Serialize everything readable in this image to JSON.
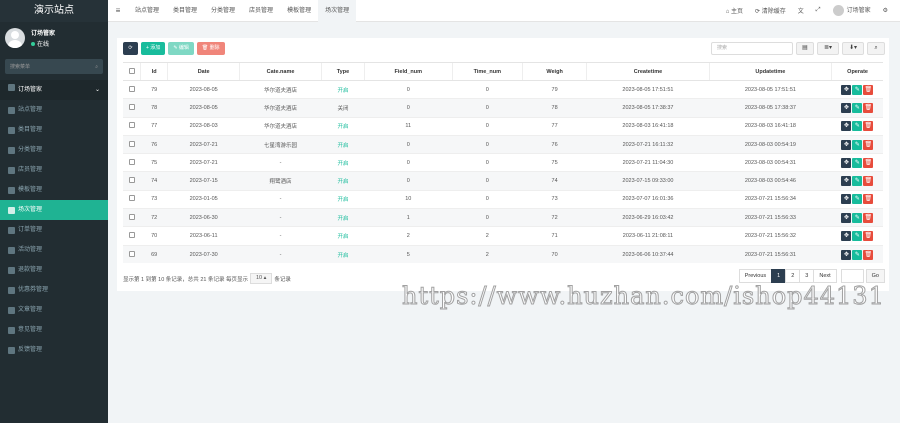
{
  "sidebar": {
    "brand": "演示站点",
    "user_name": "订场管家",
    "user_status": "在线",
    "search_placeholder": "搜索菜单",
    "group_label": "订场管家",
    "items": [
      {
        "label": "站点管理",
        "icon": "home-icon"
      },
      {
        "label": "类目管理",
        "icon": "list-icon"
      },
      {
        "label": "分类管理",
        "icon": "folder-icon"
      },
      {
        "label": "店员管理",
        "icon": "users-icon"
      },
      {
        "label": "模板管理",
        "icon": "template-icon"
      },
      {
        "label": "场次管理",
        "icon": "grid-icon",
        "active": true
      },
      {
        "label": "订单管理",
        "icon": "order-icon"
      },
      {
        "label": "活动管理",
        "icon": "activity-icon"
      },
      {
        "label": "退款管理",
        "icon": "refund-icon"
      },
      {
        "label": "优惠券管理",
        "icon": "coupon-icon"
      },
      {
        "label": "文章管理",
        "icon": "article-icon"
      },
      {
        "label": "意见管理",
        "icon": "comment-icon"
      },
      {
        "label": "反馈管理",
        "icon": "feedback-icon"
      }
    ]
  },
  "topnav": {
    "toggle_icon": "menu-icon",
    "tabs": [
      "站点管理",
      "类目管理",
      "分类管理",
      "店员管理",
      "模板管理",
      "场次管理"
    ],
    "active_tab": 5,
    "home": "主页",
    "clear_cache": "清除缓存",
    "user": "订场管家"
  },
  "toolbar": {
    "add": "+ 添加",
    "edit": "✎ 编辑",
    "delete": "🗑 删除",
    "search_placeholder": "搜索"
  },
  "table": {
    "headers": [
      "Id",
      "Date",
      "Cate.name",
      "Type",
      "Field_num",
      "Time_num",
      "Weigh",
      "Createtime",
      "Updatetime",
      "Operate"
    ],
    "rows": [
      {
        "id": "79",
        "date": "2023-08-05",
        "cate": "华尔道夫酒店",
        "type": "开启",
        "on": true,
        "field": "0",
        "time": "0",
        "weigh": "79",
        "create": "2023-08-05 17:51:51",
        "update": "2023-08-05 17:51:51"
      },
      {
        "id": "78",
        "date": "2023-08-05",
        "cate": "华尔道夫酒店",
        "type": "关闭",
        "on": false,
        "field": "0",
        "time": "0",
        "weigh": "78",
        "create": "2023-08-05 17:38:37",
        "update": "2023-08-05 17:38:37"
      },
      {
        "id": "77",
        "date": "2023-08-03",
        "cate": "华尔道夫酒店",
        "type": "开启",
        "on": true,
        "field": "11",
        "time": "0",
        "weigh": "77",
        "create": "2023-08-03 16:41:18",
        "update": "2023-08-03 16:41:18"
      },
      {
        "id": "76",
        "date": "2023-07-21",
        "cate": "七星湾游乐园",
        "type": "开启",
        "on": true,
        "field": "0",
        "time": "0",
        "weigh": "76",
        "create": "2023-07-21 16:11:32",
        "update": "2023-08-03 00:54:19"
      },
      {
        "id": "75",
        "date": "2023-07-21",
        "cate": "-",
        "type": "开启",
        "on": true,
        "field": "0",
        "time": "0",
        "weigh": "75",
        "create": "2023-07-21 11:04:30",
        "update": "2023-08-03 00:54:31"
      },
      {
        "id": "74",
        "date": "2023-07-15",
        "cate": "翔鹭酒店",
        "type": "开启",
        "on": true,
        "field": "0",
        "time": "0",
        "weigh": "74",
        "create": "2023-07-15 09:33:00",
        "update": "2023-08-03 00:54:46"
      },
      {
        "id": "73",
        "date": "2023-01-05",
        "cate": "-",
        "type": "开启",
        "on": true,
        "field": "10",
        "time": "0",
        "weigh": "73",
        "create": "2023-07-07 16:01:36",
        "update": "2023-07-21 15:56:34"
      },
      {
        "id": "72",
        "date": "2023-06-30",
        "cate": "-",
        "type": "开启",
        "on": true,
        "field": "1",
        "time": "0",
        "weigh": "72",
        "create": "2023-06-29 16:03:42",
        "update": "2023-07-21 15:56:33"
      },
      {
        "id": "70",
        "date": "2023-06-11",
        "cate": "-",
        "type": "开启",
        "on": true,
        "field": "2",
        "time": "2",
        "weigh": "71",
        "create": "2023-06-11 21:08:11",
        "update": "2023-07-21 15:56:32"
      },
      {
        "id": "69",
        "date": "2023-07-30",
        "cate": "-",
        "type": "开启",
        "on": true,
        "field": "5",
        "time": "2",
        "weigh": "70",
        "create": "2023-06-06 10:37:44",
        "update": "2023-07-21 15:56:31"
      }
    ]
  },
  "footer": {
    "info_prefix": "显示第 1 到第 10 条记录，总共 21 条记录 每页显示",
    "page_size": "10 ▴",
    "info_suffix": "条记录",
    "previous": "Previous",
    "pages": [
      "1",
      "2",
      "3"
    ],
    "current_page": "1",
    "next": "Next",
    "go": "Go"
  },
  "watermark": "https://www.huzhan.com/ishop44131",
  "colors": {
    "accent": "#18bc9c",
    "dark": "#2c3e50",
    "danger": "#e74c3c",
    "sidebar": "#222d32"
  }
}
